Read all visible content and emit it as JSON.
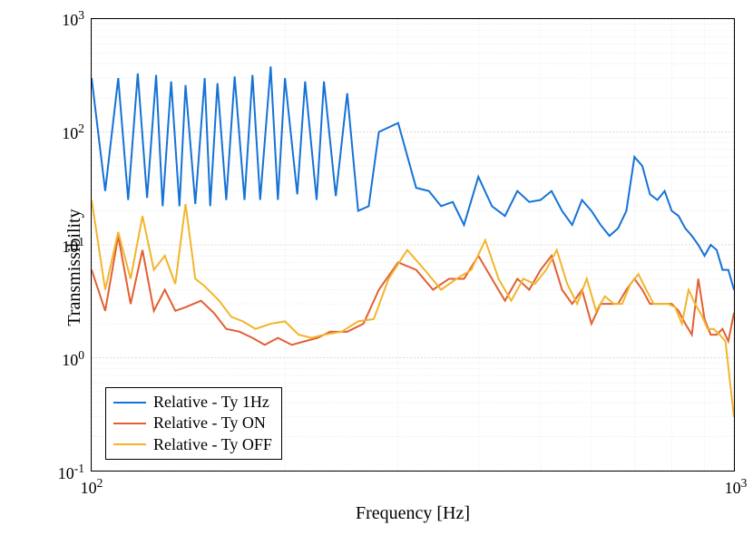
{
  "chart_data": {
    "type": "line",
    "xlabel": "Frequency [Hz]",
    "ylabel": "Transmissibility",
    "x_scale": "log",
    "y_scale": "log",
    "xlim": [
      100,
      1000
    ],
    "ylim": [
      0.1,
      1000
    ],
    "x_ticks_major": [
      100,
      1000
    ],
    "x_tick_labels": [
      "10^2",
      "10^3"
    ],
    "y_ticks_major": [
      0.1,
      1,
      10,
      100,
      1000
    ],
    "y_tick_labels": [
      "10^-1",
      "10^0",
      "10^1",
      "10^2",
      "10^3"
    ],
    "grid": true,
    "legend_position": "lower-left",
    "series": [
      {
        "name": "Relative - Ty 1Hz",
        "color": "#1572D6",
        "x": [
          100,
          105,
          110,
          114,
          118,
          122,
          126,
          129,
          133,
          137,
          140,
          145,
          150,
          153,
          157,
          162,
          167,
          173,
          178,
          183,
          190,
          195,
          200,
          209,
          215,
          224,
          230,
          240,
          250,
          260,
          270,
          280,
          300,
          320,
          335,
          350,
          365,
          380,
          400,
          420,
          440,
          460,
          480,
          500,
          520,
          540,
          560,
          580,
          600,
          620,
          640,
          660,
          680,
          700,
          720,
          740,
          760,
          780,
          800,
          820,
          840,
          860,
          880,
          900,
          920,
          940,
          960,
          980,
          1000
        ],
        "values": [
          300,
          30,
          300,
          25,
          330,
          26,
          320,
          22,
          280,
          22,
          260,
          23,
          300,
          22,
          270,
          25,
          310,
          25,
          320,
          25,
          380,
          25,
          300,
          28,
          280,
          25,
          280,
          27,
          220,
          20,
          22,
          100,
          120,
          32,
          30,
          22,
          24,
          15,
          40,
          22,
          18,
          30,
          24,
          25,
          30,
          20,
          15,
          25,
          20,
          15,
          12,
          14,
          20,
          60,
          50,
          28,
          25,
          30,
          20,
          18,
          14,
          12,
          10,
          8,
          10,
          9,
          6,
          6,
          4
        ]
      },
      {
        "name": "Relative - Ty ON",
        "color": "#E35F33",
        "x": [
          100,
          105,
          110,
          115,
          120,
          125,
          130,
          135,
          140,
          148,
          155,
          162,
          170,
          178,
          186,
          195,
          205,
          215,
          225,
          235,
          250,
          265,
          280,
          300,
          320,
          340,
          360,
          380,
          400,
          420,
          440,
          460,
          480,
          500,
          520,
          540,
          560,
          580,
          600,
          620,
          640,
          660,
          680,
          700,
          720,
          740,
          760,
          780,
          800,
          820,
          840,
          860,
          880,
          900,
          920,
          940,
          960,
          980,
          1000
        ],
        "values": [
          6,
          2.6,
          12,
          3,
          9,
          2.6,
          4,
          2.6,
          2.8,
          3.2,
          2.5,
          1.8,
          1.7,
          1.5,
          1.3,
          1.5,
          1.3,
          1.4,
          1.5,
          1.7,
          1.7,
          2.0,
          4,
          7,
          6,
          4,
          5,
          5,
          8,
          5,
          3.2,
          5,
          4,
          6,
          8,
          4,
          3,
          4,
          2,
          3,
          3,
          3,
          4,
          5,
          4,
          3,
          3,
          3,
          3,
          2.6,
          2,
          1.6,
          5,
          2.2,
          1.6,
          1.6,
          1.8,
          1.4,
          2.5
        ]
      },
      {
        "name": "Relative - Ty OFF",
        "color": "#F2B52C",
        "x": [
          100,
          105,
          110,
          115,
          120,
          125,
          130,
          135,
          140,
          145,
          150,
          158,
          165,
          172,
          180,
          190,
          200,
          210,
          220,
          230,
          245,
          260,
          275,
          290,
          310,
          330,
          350,
          370,
          390,
          410,
          430,
          450,
          470,
          490,
          510,
          530,
          550,
          570,
          590,
          610,
          630,
          650,
          670,
          690,
          710,
          730,
          750,
          770,
          790,
          810,
          830,
          850,
          870,
          890,
          910,
          930,
          950,
          970,
          1000
        ],
        "values": [
          25,
          4,
          13,
          5,
          18,
          6,
          8,
          4.5,
          23,
          5,
          4.3,
          3.2,
          2.3,
          2.1,
          1.8,
          2.0,
          2.1,
          1.6,
          1.5,
          1.6,
          1.7,
          2.1,
          2.2,
          5,
          9,
          6,
          4,
          5,
          6,
          11,
          5,
          3.2,
          5,
          4.5,
          6,
          9,
          4.5,
          3,
          5,
          2.6,
          3.5,
          3,
          3,
          4.5,
          5.5,
          4,
          3,
          3,
          3,
          2.8,
          2,
          4,
          3,
          2.4,
          1.8,
          1.8,
          1.6,
          1.4,
          0.3
        ]
      }
    ]
  },
  "legend": {
    "items": [
      {
        "label": "Relative - Ty 1Hz",
        "color": "#1572D6"
      },
      {
        "label": "Relative - Ty ON",
        "color": "#E35F33"
      },
      {
        "label": "Relative - Ty OFF",
        "color": "#F2B52C"
      }
    ]
  }
}
